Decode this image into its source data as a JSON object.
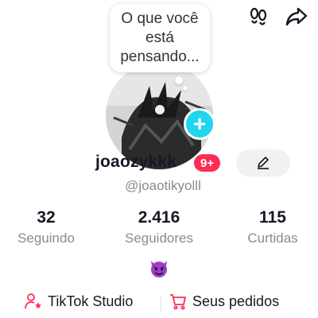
{
  "note": {
    "text": "O que você está pensando..."
  },
  "profile": {
    "username": "joaozykkk",
    "notification_badge": "9+",
    "handle": "@joaotikyolll"
  },
  "stats": [
    {
      "value": "32",
      "label": "Seguindo"
    },
    {
      "value": "2.416",
      "label": "Seguidores"
    },
    {
      "value": "115",
      "label": "Curtidas"
    }
  ],
  "bio_emoji": "😈",
  "links": {
    "studio": "TikTok Studio",
    "orders": "Seus pedidos"
  },
  "colors": {
    "accent_pink": "#fe2c55",
    "accent_cyan": "#20d5ec",
    "secondary_text": "#8a8b91"
  },
  "icons": {
    "top_left": "footprints-icon",
    "top_right": "share-icon",
    "edit": "pencil-icon",
    "studio": "person-star-icon",
    "orders": "cart-icon"
  }
}
